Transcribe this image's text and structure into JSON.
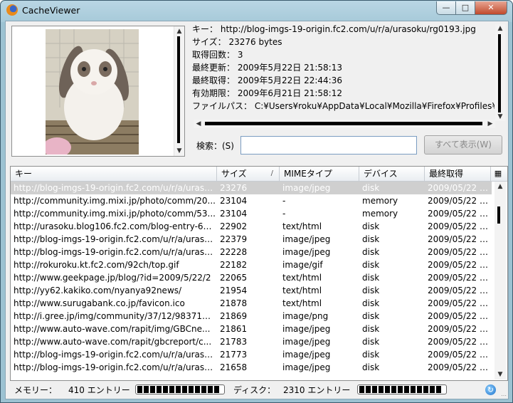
{
  "window": {
    "title": "CacheViewer"
  },
  "info": {
    "key_label": "キー：",
    "key_value": "http://blog-imgs-19-origin.fc2.com/u/r/a/urasoku/rg0193.jpg",
    "size_label": "サイズ：",
    "size_value": "23276 bytes",
    "count_label": "取得回数：",
    "count_value": "3",
    "modified_label": "最終更新：",
    "modified_value": "2009年5月22日 21:58:13",
    "fetched_label": "最終取得：",
    "fetched_value": "2009年5月22日 22:44:36",
    "expires_label": "有効期限：",
    "expires_value": "2009年6月21日 21:58:12",
    "path_label": "ファイルパス：",
    "path_value": "C:¥Users¥roku¥AppData¥Local¥Mozilla¥Firefox¥Profiles¥"
  },
  "search": {
    "label": "検索：(S)",
    "value": "",
    "button": "すべて表示(W)"
  },
  "table": {
    "columns": [
      "キー",
      "サイズ",
      "MIMEタイプ",
      "デバイス",
      "最終取得"
    ],
    "sort_indicator": "/",
    "rows": [
      [
        "http://blog-imgs-19-origin.fc2.com/u/r/a/uraso...",
        "23276",
        "image/jpeg",
        "disk",
        "2009/05/22 2..."
      ],
      [
        "http://community.img.mixi.jp/photo/comm/20...",
        "23104",
        "-",
        "memory",
        "2009/05/22 2..."
      ],
      [
        "http://community.img.mixi.jp/photo/comm/53...",
        "23104",
        "-",
        "memory",
        "2009/05/22 2..."
      ],
      [
        "http://urasoku.blog106.fc2.com/blog-entry-69...",
        "22902",
        "text/html",
        "disk",
        "2009/05/22 2..."
      ],
      [
        "http://blog-imgs-19-origin.fc2.com/u/r/a/uraso...",
        "22379",
        "image/jpeg",
        "disk",
        "2009/05/22 2..."
      ],
      [
        "http://blog-imgs-19-origin.fc2.com/u/r/a/uraso...",
        "22228",
        "image/jpeg",
        "disk",
        "2009/05/22 2..."
      ],
      [
        "http://rokuroku.kt.fc2.com/92ch/top.gif",
        "22182",
        "image/gif",
        "disk",
        "2009/05/22 2..."
      ],
      [
        "http://www.geekpage.jp/blog/?id=2009/5/22/2",
        "22065",
        "text/html",
        "disk",
        "2009/05/22 2..."
      ],
      [
        "http://yy62.kakiko.com/nyanya92news/",
        "21954",
        "text/html",
        "disk",
        "2009/05/22 2..."
      ],
      [
        "http://www.surugabank.co.jp/favicon.ico",
        "21878",
        "text/html",
        "disk",
        "2009/05/22 2..."
      ],
      [
        "http://i.gree.jp/img/community/37/12/983712...",
        "21869",
        "image/png",
        "disk",
        "2009/05/22 2..."
      ],
      [
        "http://www.auto-wave.com/rapit/img/GBCne...",
        "21861",
        "image/jpeg",
        "disk",
        "2009/05/22 2..."
      ],
      [
        "http://www.auto-wave.com/rapit/gbcreport/c...",
        "21783",
        "image/jpeg",
        "disk",
        "2009/05/22 2..."
      ],
      [
        "http://blog-imgs-19-origin.fc2.com/u/r/a/uraso...",
        "21773",
        "image/jpeg",
        "disk",
        "2009/05/22 2..."
      ],
      [
        "http://blog-imgs-19-origin.fc2.com/u/r/a/uraso...",
        "21658",
        "image/jpeg",
        "disk",
        "2009/05/22 2..."
      ]
    ]
  },
  "status": {
    "memory_label": "メモリー：",
    "memory_value": "410 エントリー",
    "disk_label": "ディスク：",
    "disk_value": "2310 エントリー"
  },
  "colors": {
    "selected_row": "#cfcfcf",
    "frame": "#9cc2d2",
    "meter": "#000000"
  }
}
